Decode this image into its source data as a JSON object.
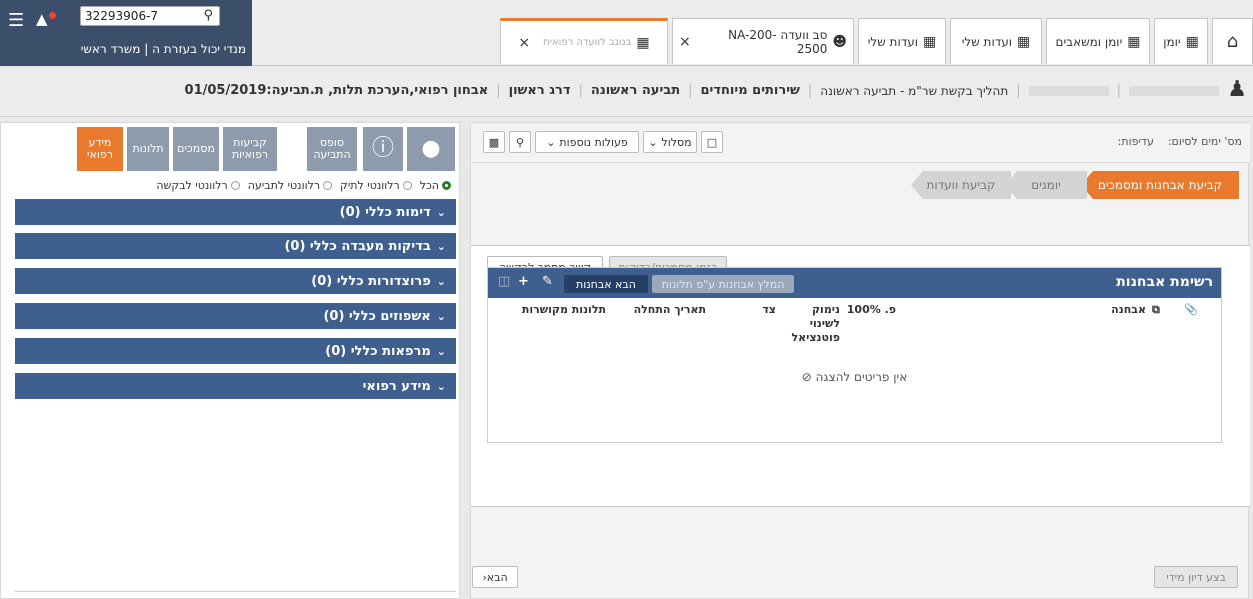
{
  "topbar": {
    "search_value": "32293906-7",
    "user_line": "מנדי יכול בעזרת ה | משרד ראשי",
    "tabs": [
      {
        "label": "יומן"
      },
      {
        "label": "יומן ומשאבים"
      },
      {
        "label": "ועדות שלי"
      },
      {
        "label": "ועדות שלי"
      },
      {
        "label": "סב וועדה NA-200-2500"
      },
      {
        "label_blurred": "בנוגב לוועדה רפואית"
      }
    ]
  },
  "crumbs": {
    "blurred_1": "",
    "blurred_2": "",
    "process": "תהליך בקשת שר\"מ - תביעה ראשונה",
    "items": [
      "שירותים מיוחדים",
      "תביעה ראשונה",
      "דרג ראשון",
      "אבחון רפואי,הערכת תלות, ת.תביעה:01/05/2019"
    ]
  },
  "toolbar": {
    "days_label": "מס' ימים לסיום:",
    "priority_label": "עדיפות:",
    "route_label": "מסלול",
    "more_actions_label": "פעולות נוספות"
  },
  "steps": {
    "active": "קביעת אבחנות ומסמכים",
    "mid": "יומנים",
    "last": "קביעת וועדות"
  },
  "panel": {
    "link_doc_label": "קשר מסמך לבקשה",
    "order_docs_label": "הזמן מסמכים/בדיקות"
  },
  "grid": {
    "title": "רשימת אבחנות",
    "import_label": "הבא אבחנות",
    "recommend_label": "המלץ אבחנות ע\"פ תלונות",
    "columns": [
      "אבחנה",
      "פ. 100%",
      "נימוק לשינוי פוטנציאל",
      "צד",
      "תאריך התחלה",
      "תלונות מקושרות"
    ],
    "empty_text": "אין פריטים להצגה"
  },
  "footer": {
    "next_label": "הבא",
    "execute_label": "בצע דיון מידי"
  },
  "left": {
    "tabs": [
      "מידע רפואי",
      "תלונות",
      "מסמכים",
      "קביעות רפואיות",
      "סופס התביעה"
    ],
    "filters": [
      "הכל",
      "רלוונטי לתיק",
      "רלוונטי לתביעה",
      "רלוונטי לבקשה"
    ],
    "sections": [
      "דימות כללי (0)",
      "בדיקות מעבדה כללי (0)",
      "פרוצדורות כללי (0)",
      "אשפוזים כללי (0)",
      "מרפאות כללי (0)",
      "מידע רפואי"
    ]
  },
  "colors": {
    "accent": "#e8792d",
    "navy": "#3f5f8e",
    "user_bg": "#3b4e6a",
    "tab_grey": "#8d9bad"
  }
}
